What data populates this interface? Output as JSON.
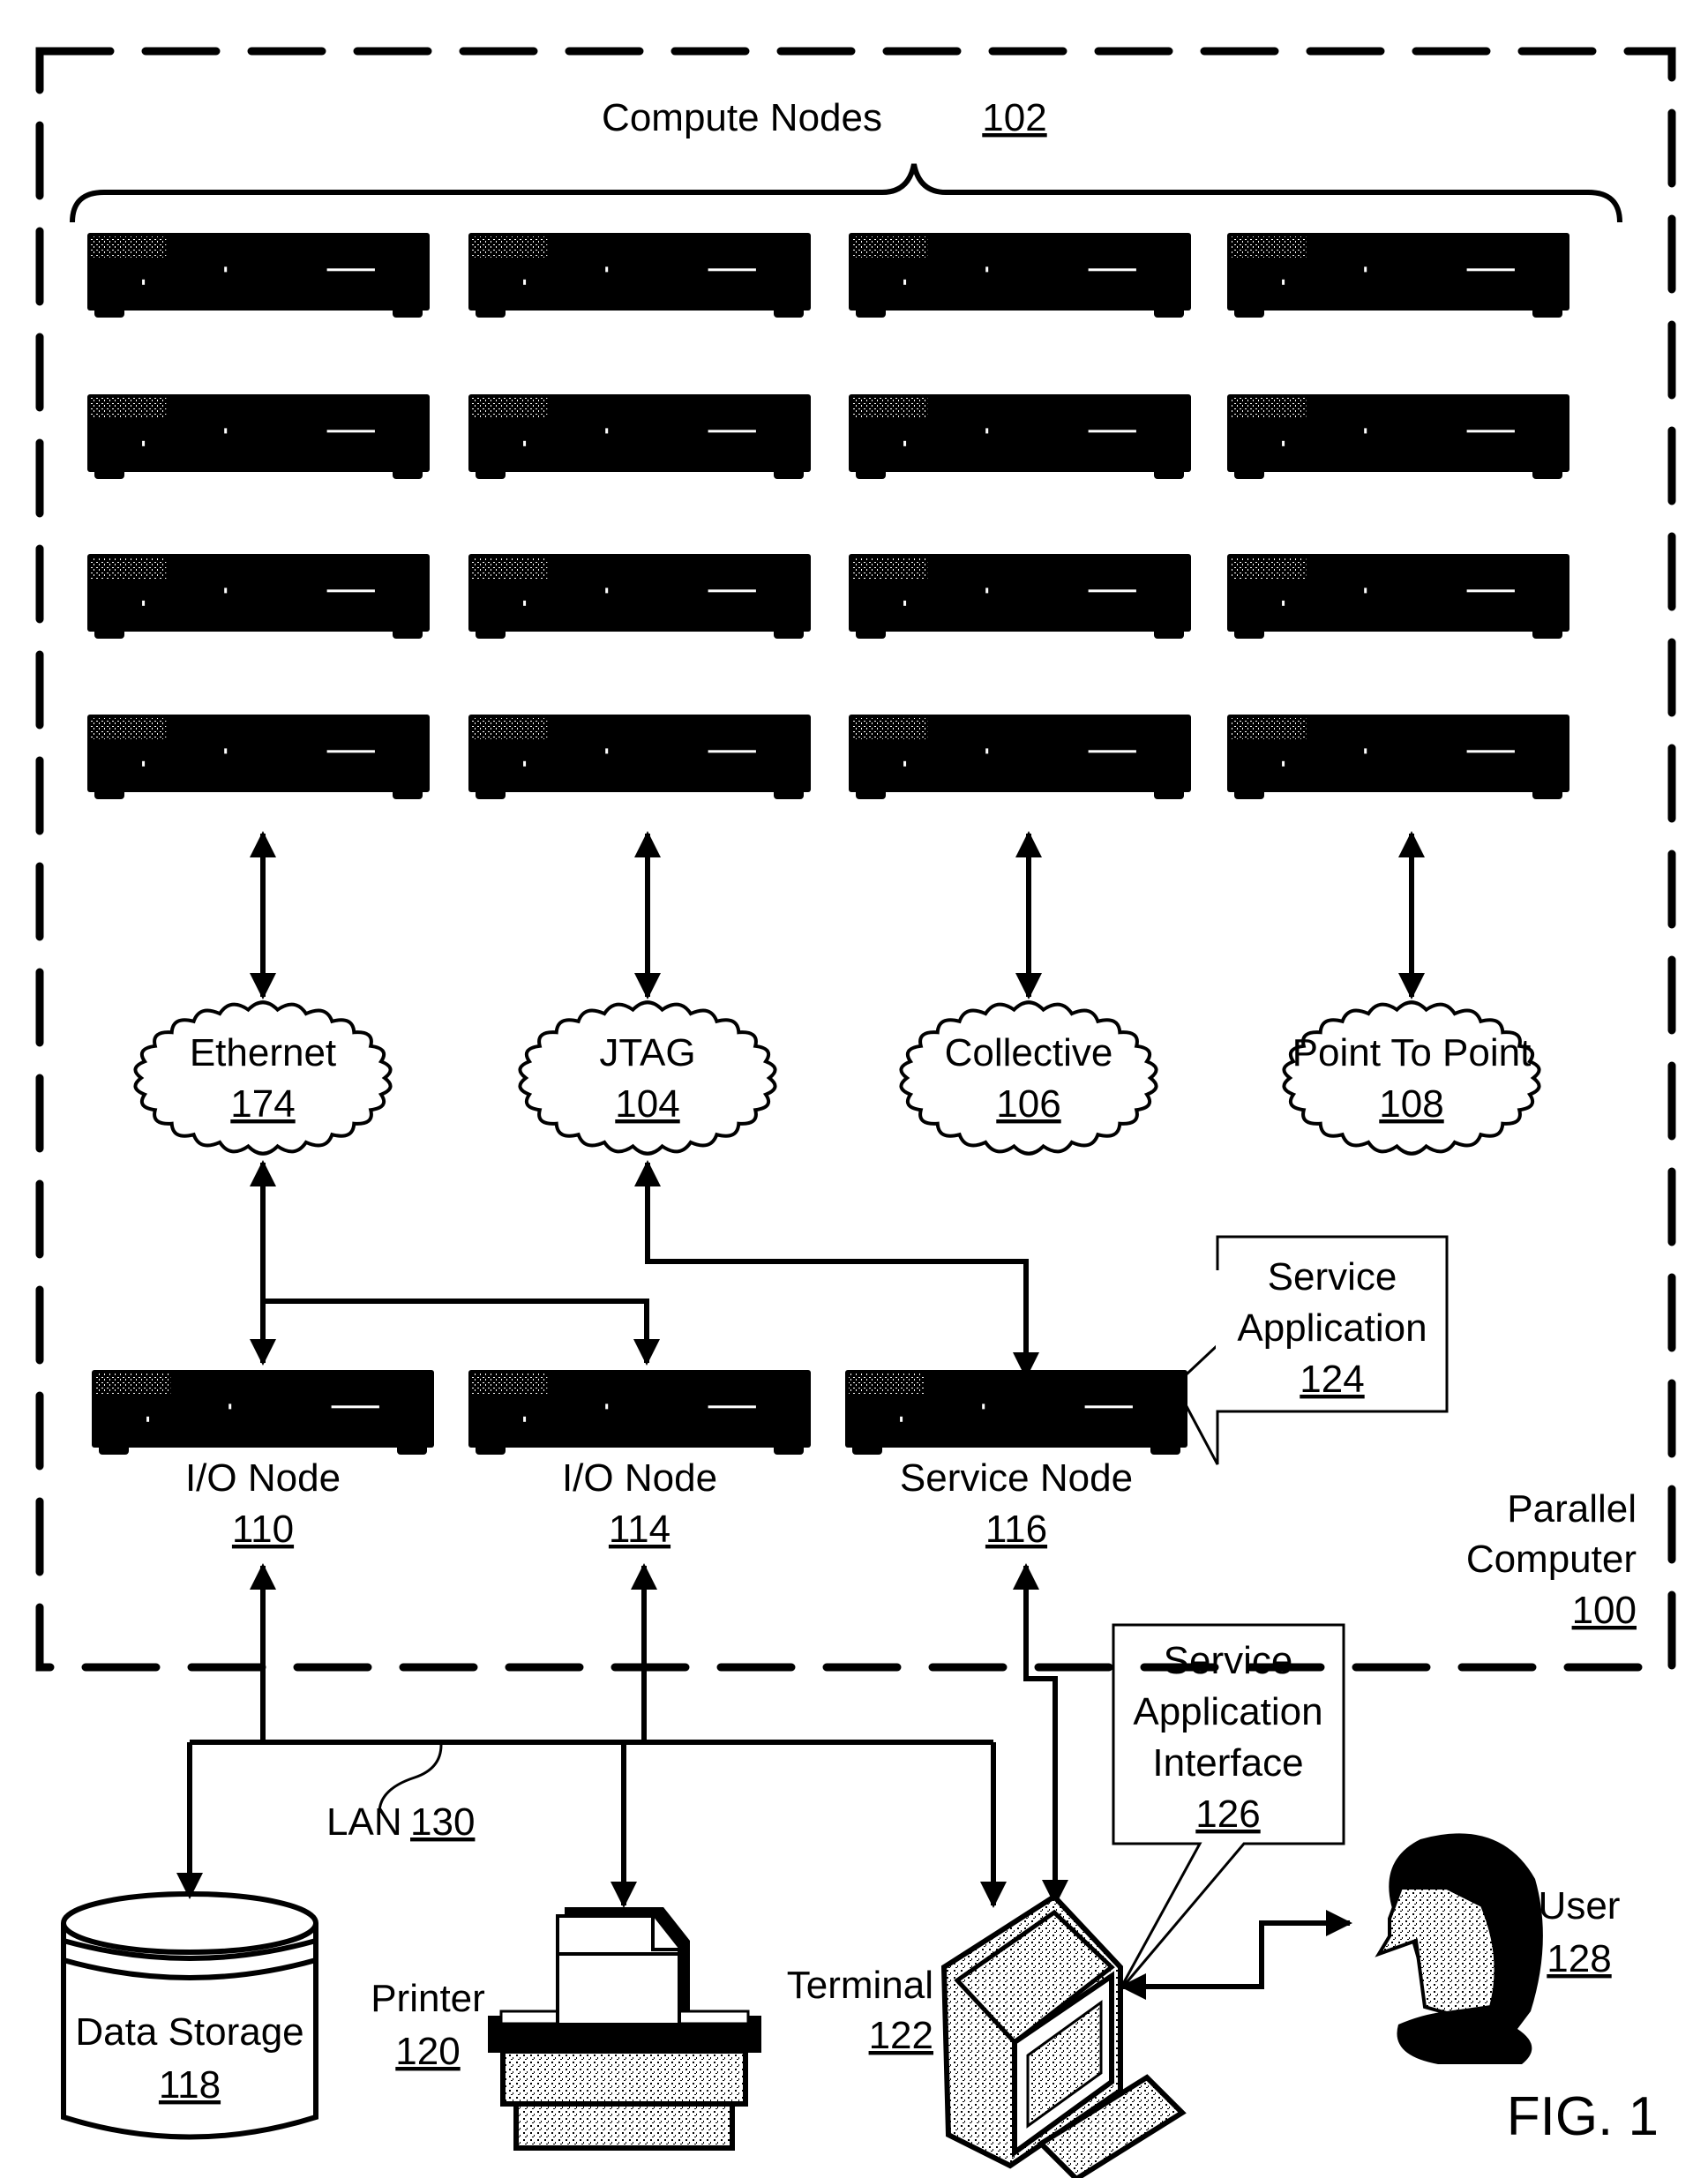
{
  "figure": {
    "label": "FIG. 1",
    "container": {
      "name": "Parallel",
      "name2": "Computer",
      "ref": "100"
    }
  },
  "compute_nodes": {
    "label": "Compute Nodes",
    "ref": "102",
    "rows": 4,
    "cols": 4
  },
  "networks": [
    {
      "name": "Ethernet",
      "ref": "174"
    },
    {
      "name": "JTAG",
      "ref": "104"
    },
    {
      "name": "Collective",
      "ref": "106"
    },
    {
      "name": "Point To Point",
      "ref": "108"
    }
  ],
  "lower_nodes": [
    {
      "name": "I/O Node",
      "ref": "110"
    },
    {
      "name": "I/O Node",
      "ref": "114"
    },
    {
      "name": "Service Node",
      "ref": "116"
    }
  ],
  "service_application": {
    "line1": "Service",
    "line2": "Application",
    "ref": "124"
  },
  "service_application_interface": {
    "line1": "Service",
    "line2": "Application",
    "line3": "Interface",
    "ref": "126"
  },
  "lan": {
    "name": "LAN",
    "ref": "130"
  },
  "devices": {
    "data_storage": {
      "name": "Data Storage",
      "ref": "118"
    },
    "printer": {
      "name": "Printer",
      "ref": "120"
    },
    "terminal": {
      "name": "Terminal",
      "ref": "122"
    },
    "user": {
      "name": "User",
      "ref": "128"
    }
  }
}
